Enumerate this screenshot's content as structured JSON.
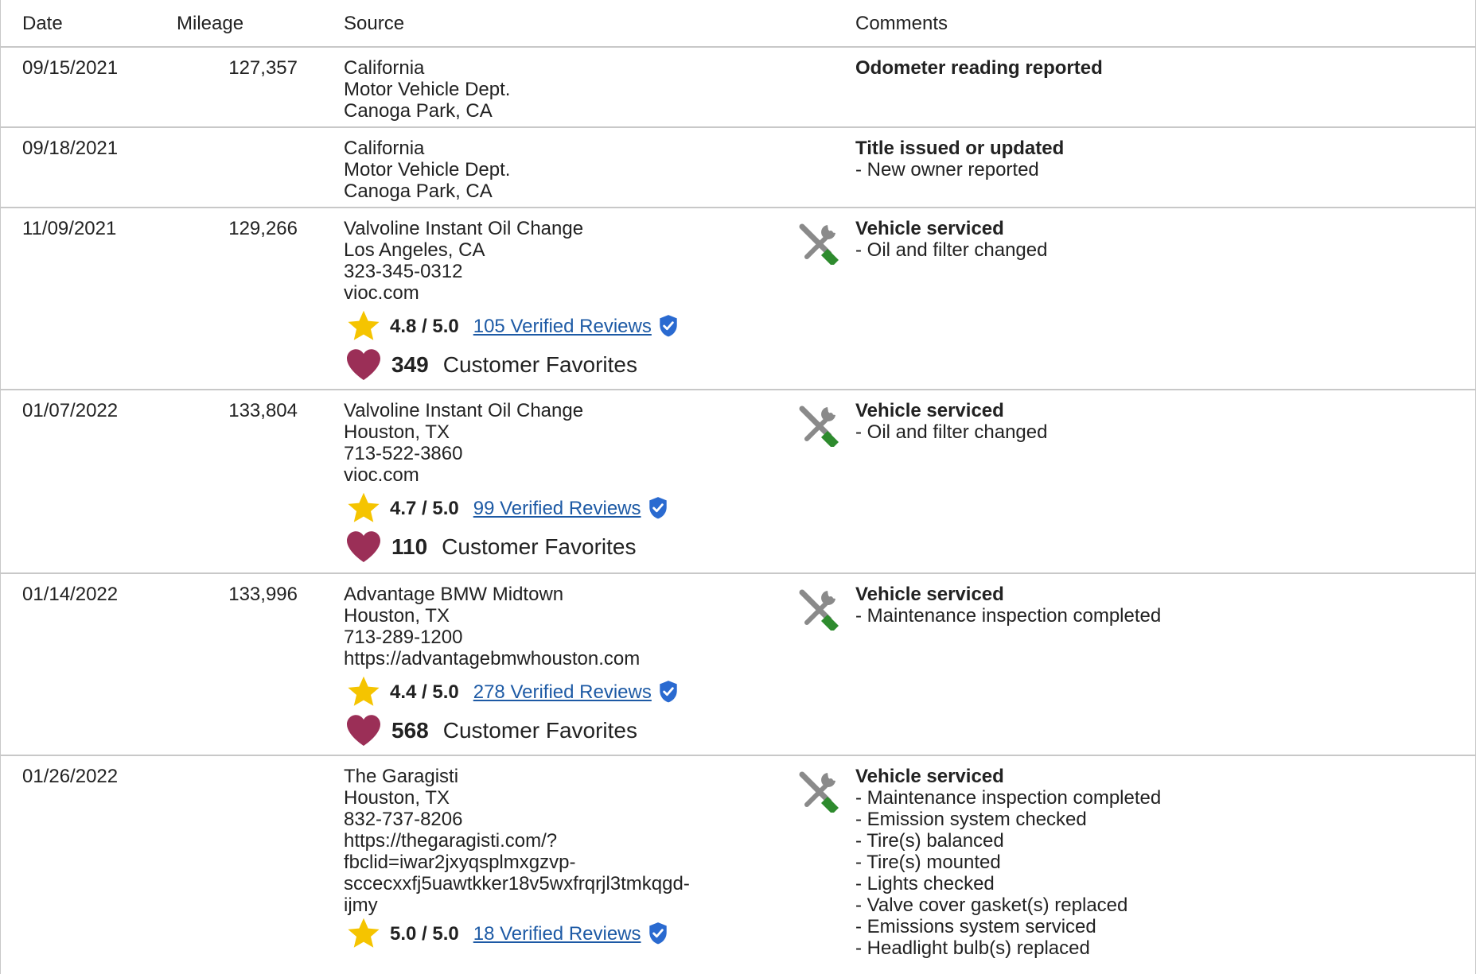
{
  "header": {
    "date": "Date",
    "mileage": "Mileage",
    "source": "Source",
    "comments": "Comments"
  },
  "rows": [
    {
      "date": "09/15/2021",
      "mileage": "127,357",
      "source": [
        "California",
        "Motor Vehicle Dept.",
        "Canoga Park, CA"
      ],
      "comment_head": "Odometer reading reported",
      "comment_items": [],
      "icon": null
    },
    {
      "date": "09/18/2021",
      "mileage": "",
      "source": [
        "California",
        "Motor Vehicle Dept.",
        "Canoga Park, CA"
      ],
      "comment_head": "Title issued or updated",
      "comment_items": [
        "- New owner reported"
      ],
      "icon": null
    },
    {
      "date": "11/09/2021",
      "mileage": "129,266",
      "source": [
        "Valvoline Instant Oil Change",
        "Los Angeles, CA",
        "323-345-0312",
        "vioc.com"
      ],
      "rating": "4.8 / 5.0",
      "reviews": "105 Verified Reviews",
      "favorites_count": "349",
      "favorites_label": "Customer Favorites",
      "comment_head": "Vehicle serviced",
      "comment_items": [
        "- Oil and filter changed"
      ],
      "icon": "wrench-screwdriver-icon"
    },
    {
      "date": "01/07/2022",
      "mileage": "133,804",
      "source": [
        "Valvoline Instant Oil Change",
        "Houston, TX",
        "713-522-3860",
        "vioc.com"
      ],
      "rating": "4.7 / 5.0",
      "reviews": "99 Verified Reviews",
      "favorites_count": "110",
      "favorites_label": "Customer Favorites",
      "comment_head": "Vehicle serviced",
      "comment_items": [
        "- Oil and filter changed"
      ],
      "icon": "wrench-screwdriver-icon"
    },
    {
      "date": "01/14/2022",
      "mileage": "133,996",
      "source": [
        "Advantage BMW Midtown",
        "Houston, TX",
        "713-289-1200",
        "https://advantagebmwhouston.com"
      ],
      "rating": "4.4 / 5.0",
      "reviews": "278 Verified Reviews",
      "favorites_count": "568",
      "favorites_label": "Customer Favorites",
      "comment_head": "Vehicle serviced",
      "comment_items": [
        "- Maintenance inspection completed"
      ],
      "icon": "wrench-screwdriver-icon"
    },
    {
      "date": "01/26/2022",
      "mileage": "",
      "source": [
        "The Garagisti",
        "Houston, TX",
        "832-737-8206",
        "https://thegaragisti.com/?",
        "fbclid=iwar2jxyqsplmxgzvp-",
        "sccecxxfj5uawtkker18v5wxfrqrjl3tmkqgd-",
        "ijmy"
      ],
      "rating": "5.0 / 5.0",
      "reviews": "18 Verified Reviews",
      "comment_head": "Vehicle serviced",
      "comment_items": [
        "- Maintenance inspection completed",
        "- Emission system checked",
        "- Tire(s) balanced",
        "- Tire(s) mounted",
        "- Lights checked",
        "- Valve cover gasket(s) replaced",
        "- Emissions system serviced",
        "- Headlight bulb(s) replaced"
      ],
      "icon": "wrench-screwdriver-icon"
    }
  ],
  "colors": {
    "star": "#f5c400",
    "heart": "#9b2f57",
    "link": "#1d5aa5",
    "shield": "#2a6ad0",
    "wrench_gray": "#8a8a8a",
    "screwdriver_green": "#2e8b2e",
    "border": "#c8c8c8"
  }
}
